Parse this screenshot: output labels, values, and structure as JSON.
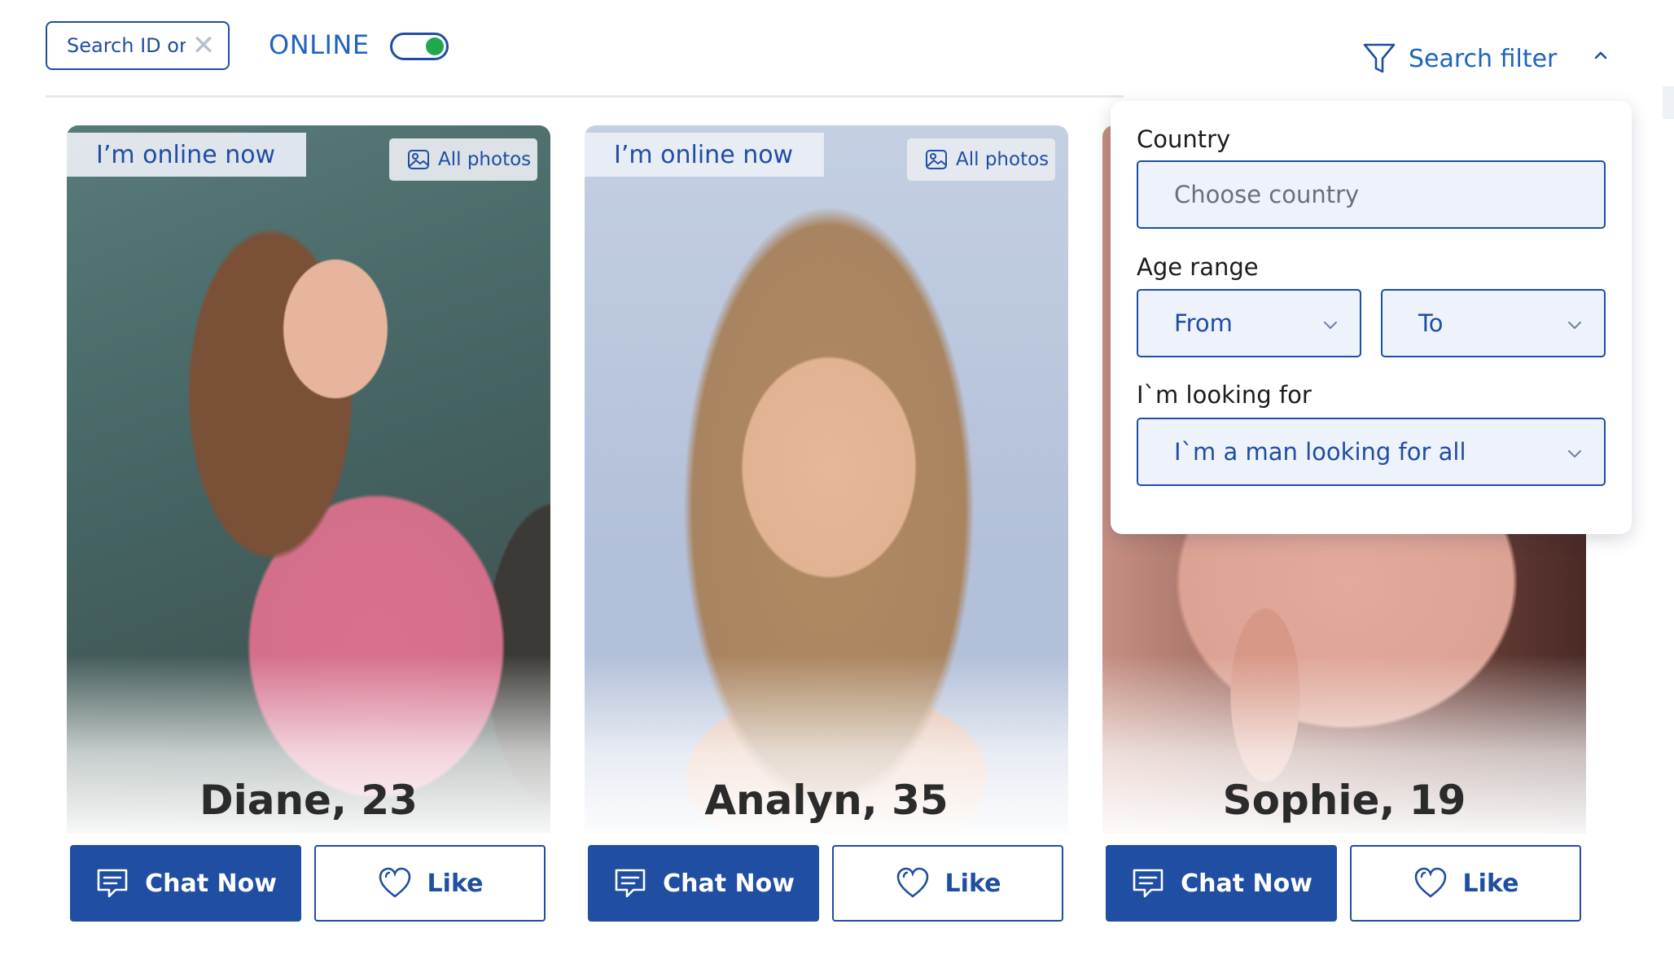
{
  "topbar": {
    "search_placeholder": "Search ID or name",
    "online_label": "ONLINE",
    "online_toggle": "on",
    "filter_label": "Search filter"
  },
  "cards": [
    {
      "badge": "I’m online now",
      "photos_label": "All photos",
      "name": "Diane, 23",
      "chat_label": "Chat Now",
      "like_label": "Like"
    },
    {
      "badge": "I’m online now",
      "photos_label": "All photos",
      "name": "Analyn, 35",
      "chat_label": "Chat Now",
      "like_label": "Like"
    },
    {
      "badge": "",
      "photos_label": "",
      "name": "Sophie, 19",
      "chat_label": "Chat Now",
      "like_label": "Like"
    }
  ],
  "filter": {
    "country_label": "Country",
    "country_placeholder": "Choose country",
    "age_label": "Age range",
    "age_from": "From",
    "age_to": "To",
    "looking_label": "I`m looking for",
    "looking_value": "I`m a man looking for all"
  },
  "colors": {
    "brand_blue": "#1f4ea3",
    "link_blue": "#1f64c0",
    "toggle_green": "#1fa84e"
  }
}
